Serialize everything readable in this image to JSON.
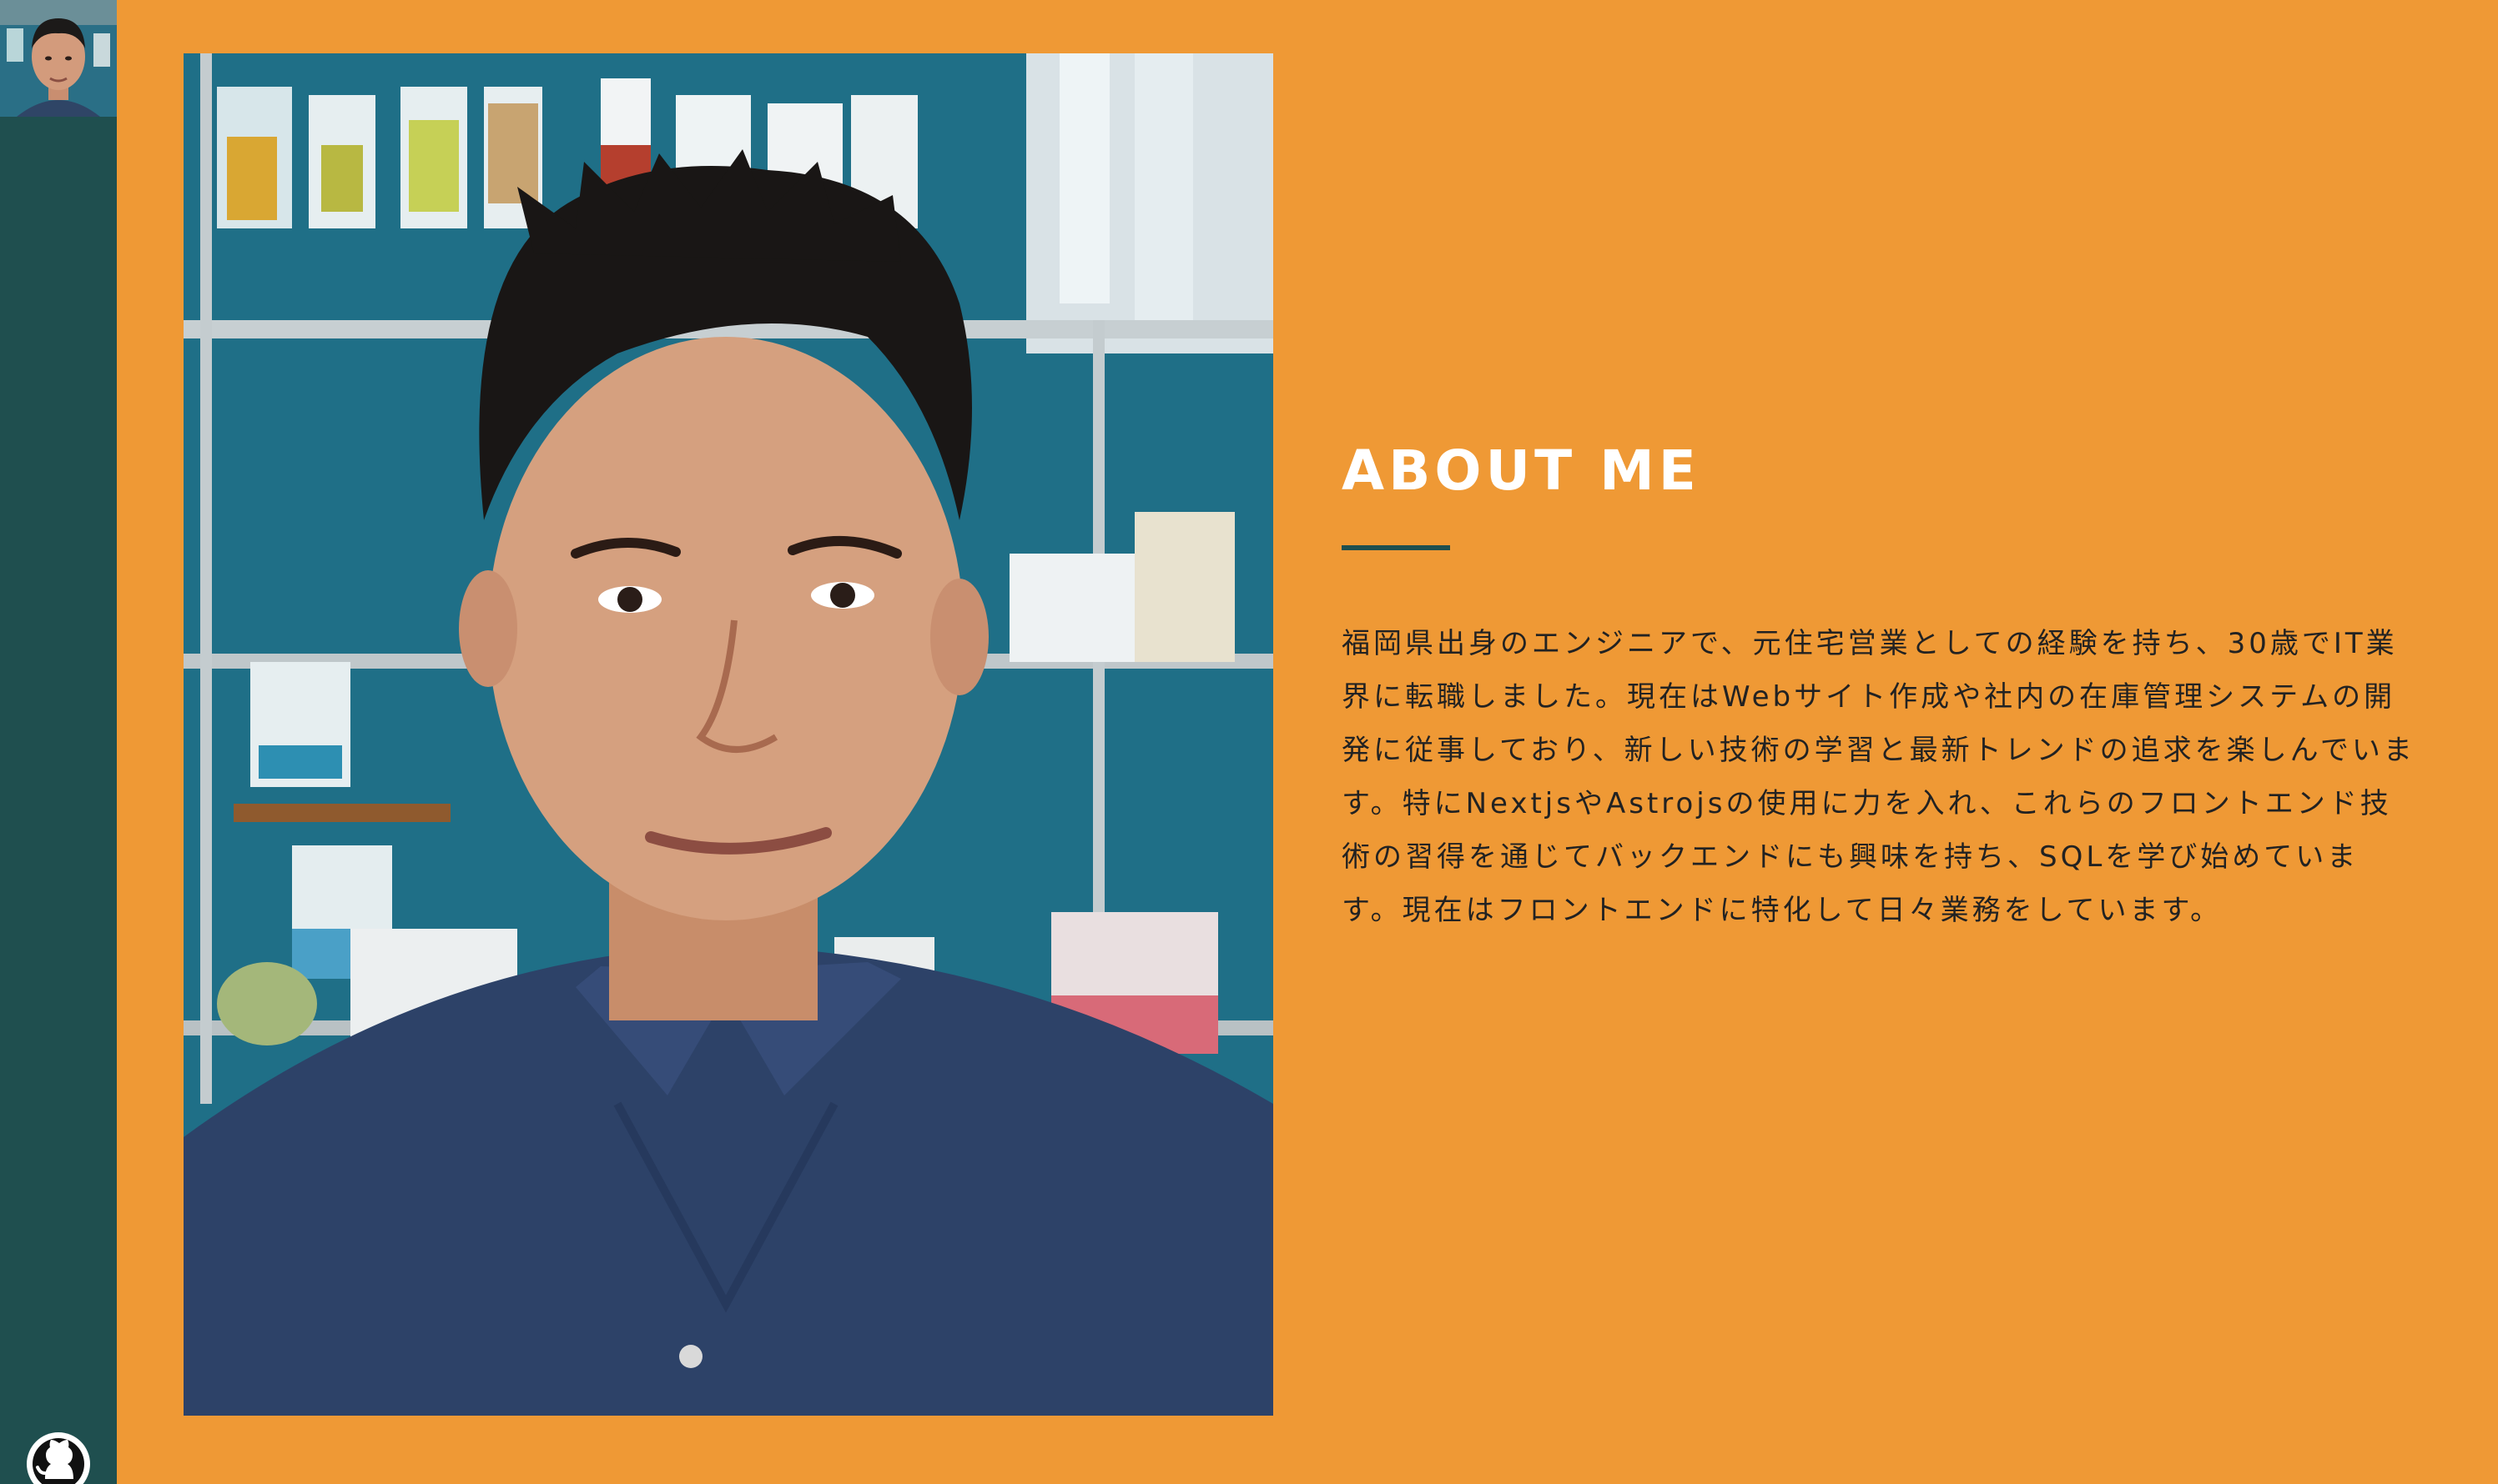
{
  "sidebar": {
    "avatar_icon": "person-avatar",
    "github_icon": "github-icon"
  },
  "about": {
    "title": "ABOUT ME",
    "body": "福岡県出身のエンジニアで、元住宅営業としての経験を持ち、30歳でIT業界に転職しました。現在はWebサイト作成や社内の在庫管理システムの開発に従事しており、新しい技術の学習と最新トレンドの追求を楽しんでいます。特にNextjsやAstrojsの使用に力を入れ、これらのフロントエンド技術の習得を通じてバックエンドにも興味を持ち、SQLを学び始めています。現在はフロントエンドに特化して日々業務をしています。"
  },
  "colors": {
    "background": "#ef9935",
    "sidebar": "#1f4f4f",
    "title": "#ffffff",
    "text": "#222222",
    "rule": "#1f4f4f"
  }
}
